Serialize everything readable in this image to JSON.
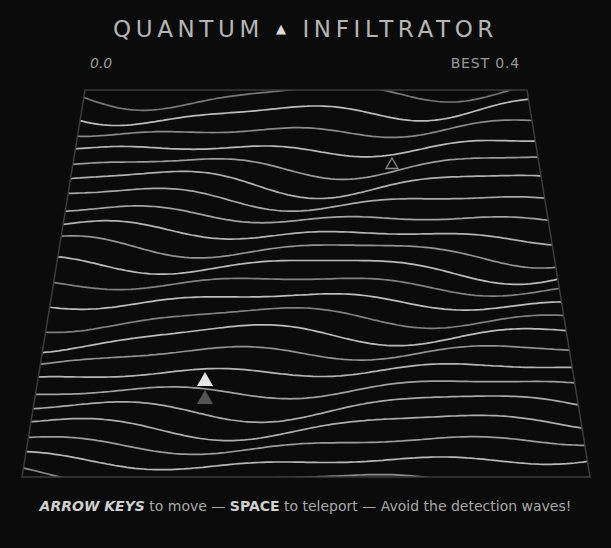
{
  "title": [
    "QUANTUM",
    "▲",
    "INFILTRATOR"
  ],
  "score": "0.0",
  "best": "BEST 0.4",
  "board": {
    "entities": [
      {
        "kind": "player"
      },
      {
        "kind": "ghost"
      },
      {
        "kind": "sentry"
      }
    ]
  },
  "instructions": [
    {
      "text": "ARROW KEYS",
      "kind": "key-italic"
    },
    {
      "text": " to move — ",
      "kind": "plain"
    },
    {
      "text": "SPACE",
      "kind": "key"
    },
    {
      "text": " to teleport — Avoid the detection waves!",
      "kind": "plain"
    }
  ]
}
